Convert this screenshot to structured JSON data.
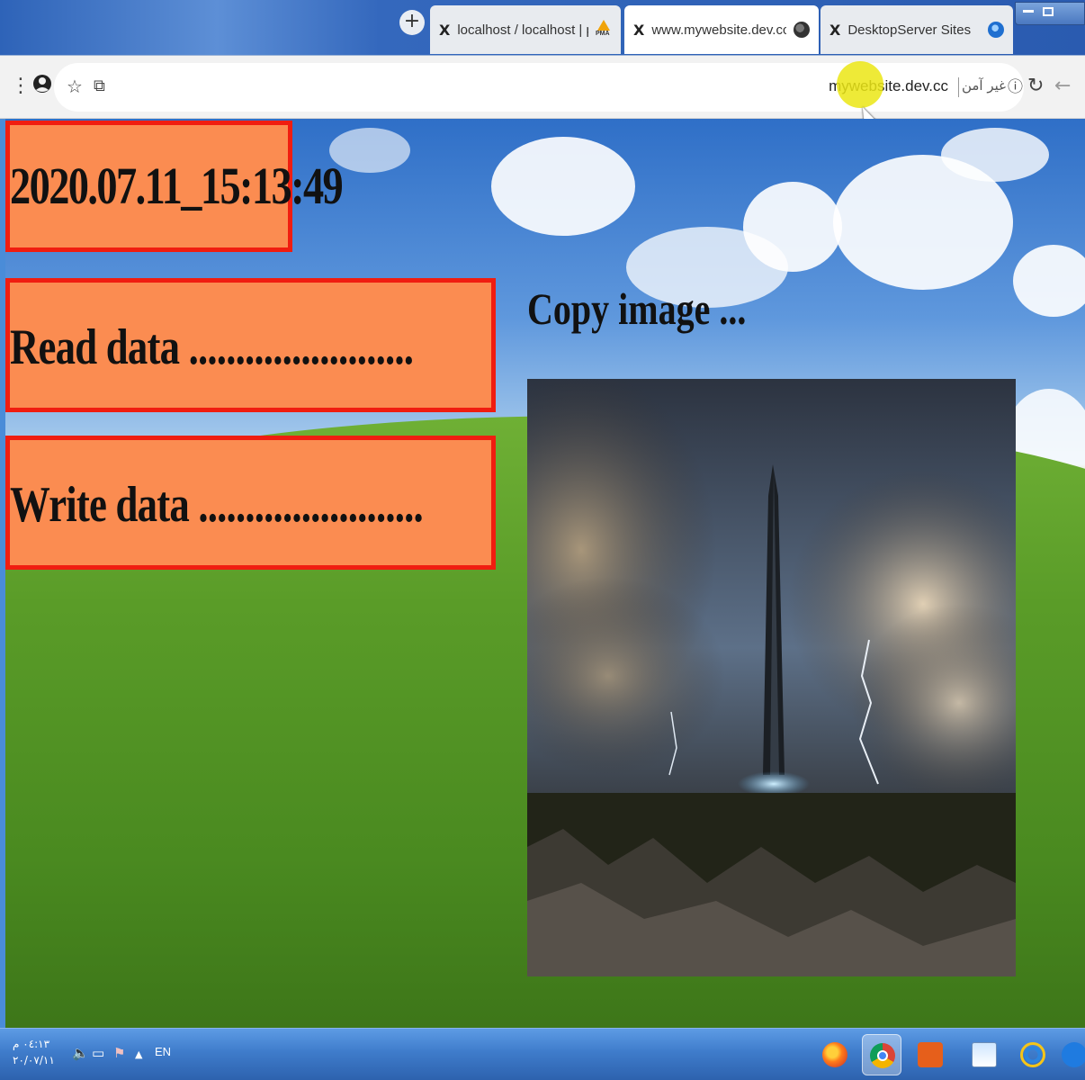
{
  "browser": {
    "tabs": [
      {
        "close": "X",
        "title": "localhost / localhost | phpMyAdr",
        "icon": "phpmyadmin-icon",
        "active": false
      },
      {
        "close": "X",
        "title": "www.mywebsite.dev.cc",
        "icon": "globe-icon",
        "active": true
      },
      {
        "close": "X",
        "title": "DesktopServer Sites",
        "icon": "desktopserver-icon",
        "active": false
      }
    ],
    "new_tab": "+",
    "address": {
      "url": "mywebsite.dev.cc",
      "security_text": "غير آمن",
      "security_icon": "info-icon"
    },
    "toolbar_icons": [
      "menu-icon",
      "profile-icon",
      "star-icon",
      "extension-icon",
      "reload-icon",
      "back-icon"
    ]
  },
  "page": {
    "clock": "2020.07.11_15:13:49",
    "read_label": "Read data ........................",
    "write_label": "Write data ........................",
    "copy_label": "Copy image ...",
    "colors": {
      "panel_fill": "#fb8c51",
      "panel_border": "#f01d10"
    }
  },
  "taskbar": {
    "clock_time": "٠٤:١٣ م",
    "clock_date": "٢٠/٠٧/١١",
    "language": "EN",
    "apps": [
      "firefox-icon",
      "chrome-icon",
      "media-player-icon",
      "notepad-icon",
      "internet-explorer-icon",
      "edge-icon"
    ]
  }
}
